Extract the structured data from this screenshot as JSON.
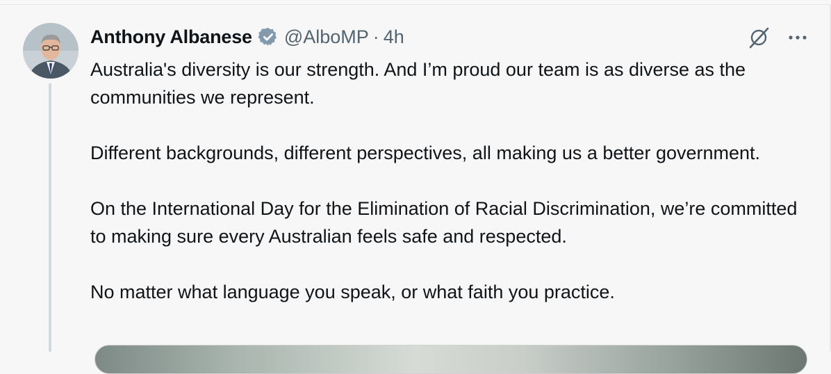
{
  "author": {
    "name": "Anthony Albanese",
    "handle": "@AlboMP",
    "separator": "·",
    "time": "4h",
    "verified": true,
    "avatar_icon": "profile-photo"
  },
  "tweet": {
    "paragraphs": [
      "Australia's diversity is our strength. And I’m proud our team is as diverse as the communities we represent.",
      "Different backgrounds, different perspectives, all making us a better government.",
      "On the International Day for the Elimination of Racial Discrimination, we’re committed to making sure every Australian feels safe and respected.",
      "No matter what language you speak, or what faith you practice."
    ]
  },
  "icons": {
    "verified": "verified-badge-icon",
    "grok": "grok-icon",
    "more": "more-icon"
  },
  "colors": {
    "text": "#0f1419",
    "secondary": "#536471",
    "thread_line": "#cfd9de",
    "verified_badge": "#829aab",
    "background": "#f7f7f7"
  }
}
